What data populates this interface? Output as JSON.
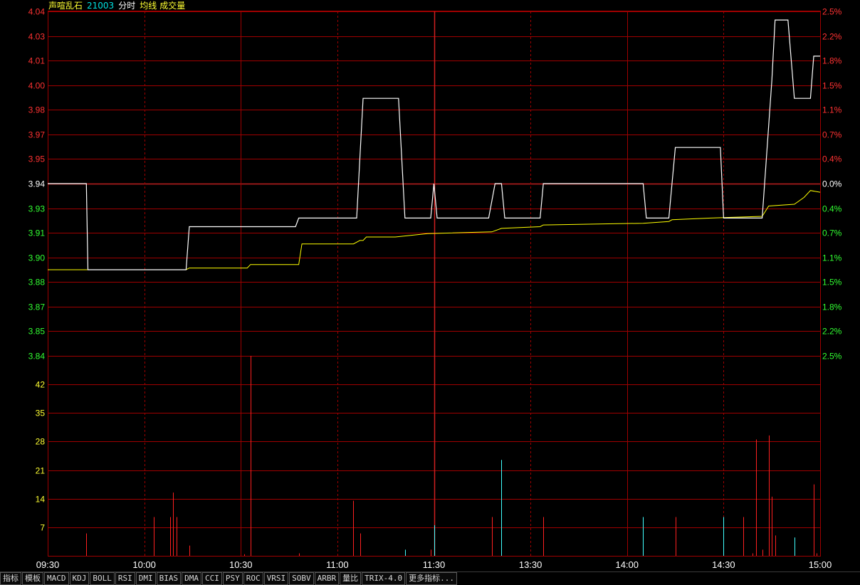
{
  "header": {
    "name": "声喧乱石",
    "code": "21003",
    "mode": "分时",
    "avg_label": "均线",
    "vol_label": "成交量"
  },
  "colors": {
    "up": "#ff3232",
    "down": "#32ff32",
    "price_line": "#ffffff",
    "avg_line": "#ffff00",
    "grid": "#a00000",
    "axis_text_vol": "#ffff32",
    "name": "#ffff32",
    "code": "#00e0e0",
    "volume_up": "#ff2020",
    "volume_down": "#40ffff"
  },
  "chart_data": {
    "type": "line",
    "title": "",
    "prev_close": 3.94,
    "price_range": [
      3.84,
      4.04
    ],
    "price_ticks": [
      "4.04",
      "4.03",
      "4.01",
      "4.00",
      "3.98",
      "3.97",
      "3.95",
      "3.94",
      "3.93",
      "3.91",
      "3.90",
      "3.88",
      "3.87",
      "3.85",
      "3.84"
    ],
    "pct_ticks": [
      "2.5%",
      "2.2%",
      "1.8%",
      "1.5%",
      "1.1%",
      "0.7%",
      "0.4%",
      "0.0%",
      "0.4%",
      "0.7%",
      "1.1%",
      "1.5%",
      "1.8%",
      "2.2%",
      "2.5%"
    ],
    "volume_ticks": [
      "42",
      "35",
      "28",
      "21",
      "14",
      "7"
    ],
    "volume_max": 49,
    "x_labels": [
      "09:30",
      "10:00",
      "10:30",
      "11:00",
      "11:30",
      "13:30",
      "14:00",
      "14:30",
      "15:00"
    ],
    "total_minutes": 240,
    "price": [
      [
        0,
        3.94
      ],
      [
        12,
        3.94
      ],
      [
        12.5,
        3.89
      ],
      [
        43,
        3.89
      ],
      [
        44,
        3.915
      ],
      [
        77,
        3.915
      ],
      [
        78,
        3.92
      ],
      [
        96,
        3.92
      ],
      [
        98,
        3.9895
      ],
      [
        109,
        3.9895
      ],
      [
        111,
        3.92
      ],
      [
        119,
        3.92
      ],
      [
        120,
        3.94
      ],
      [
        121,
        3.92
      ],
      [
        137,
        3.92
      ],
      [
        139,
        3.94
      ],
      [
        141,
        3.94
      ],
      [
        142,
        3.92
      ],
      [
        153,
        3.92
      ],
      [
        154,
        3.94
      ],
      [
        185,
        3.94
      ],
      [
        186,
        3.92
      ],
      [
        193,
        3.92
      ],
      [
        195,
        3.961
      ],
      [
        209,
        3.961
      ],
      [
        210,
        3.92
      ],
      [
        222,
        3.92
      ],
      [
        225,
        4.0
      ],
      [
        226,
        4.035
      ],
      [
        230,
        4.035
      ],
      [
        232,
        3.9895
      ],
      [
        237,
        3.9895
      ],
      [
        238,
        4.014
      ],
      [
        240,
        4.014
      ]
    ],
    "avg": [
      [
        0,
        3.89
      ],
      [
        43,
        3.89
      ],
      [
        44,
        3.891
      ],
      [
        62,
        3.891
      ],
      [
        63,
        3.893
      ],
      [
        78,
        3.893
      ],
      [
        79,
        3.905
      ],
      [
        95,
        3.905
      ],
      [
        97,
        3.907
      ],
      [
        98,
        3.907
      ],
      [
        99,
        3.909
      ],
      [
        108,
        3.909
      ],
      [
        118,
        3.911
      ],
      [
        138,
        3.912
      ],
      [
        141,
        3.914
      ],
      [
        153,
        3.915
      ],
      [
        154,
        3.916
      ],
      [
        185,
        3.917
      ],
      [
        193,
        3.918
      ],
      [
        194,
        3.919
      ],
      [
        206,
        3.92
      ],
      [
        222,
        3.921
      ],
      [
        224,
        3.927
      ],
      [
        232,
        3.928
      ],
      [
        235,
        3.932
      ],
      [
        237,
        3.936
      ],
      [
        240,
        3.935
      ]
    ],
    "volume": [
      [
        12,
        5.5,
        "up"
      ],
      [
        33,
        9.5,
        "up"
      ],
      [
        38,
        9.5,
        "up"
      ],
      [
        39,
        15.5,
        "up"
      ],
      [
        40,
        9.5,
        "up"
      ],
      [
        44,
        2.5,
        "up"
      ],
      [
        61,
        0.4,
        "up"
      ],
      [
        63,
        49,
        "up"
      ],
      [
        78,
        0.6,
        "up"
      ],
      [
        95,
        13.5,
        "up"
      ],
      [
        97,
        5.5,
        "up"
      ],
      [
        111,
        1.5,
        "down"
      ],
      [
        119,
        1.5,
        "up"
      ],
      [
        120,
        7.5,
        "down"
      ],
      [
        138,
        9.5,
        "up"
      ],
      [
        141,
        23.5,
        "down"
      ],
      [
        154,
        9.5,
        "up"
      ],
      [
        185,
        9.5,
        "down"
      ],
      [
        195,
        9.5,
        "up"
      ],
      [
        210,
        9.5,
        "down"
      ],
      [
        216,
        9.5,
        "up"
      ],
      [
        219,
        0.6,
        "up"
      ],
      [
        220,
        28.5,
        "up"
      ],
      [
        222,
        1.5,
        "up"
      ],
      [
        224,
        29.5,
        "up"
      ],
      [
        225,
        14.5,
        "up"
      ],
      [
        226,
        5,
        "up"
      ],
      [
        232,
        4.5,
        "down"
      ],
      [
        238,
        17.5,
        "up"
      ],
      [
        239,
        0.6,
        "up"
      ]
    ]
  },
  "tabs": [
    "指标",
    "模板",
    "MACD",
    "KDJ",
    "BOLL",
    "RSI",
    "DMI",
    "BIAS",
    "DMA",
    "CCI",
    "PSY",
    "ROC",
    "VRSI",
    "SOBV",
    "ARBR",
    "量比",
    "TRIX-4.0",
    "更多指标..."
  ]
}
